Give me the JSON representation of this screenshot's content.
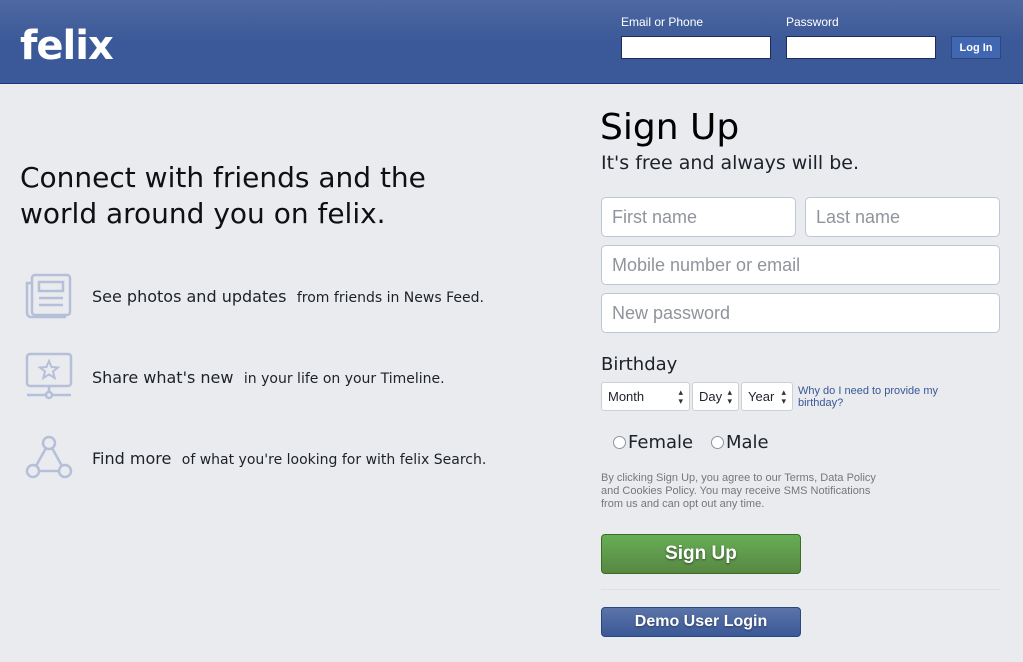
{
  "header": {
    "logo": "felix",
    "email_label": "Email or Phone",
    "password_label": "Password",
    "email_value": "",
    "password_value": "",
    "login_button": "Log In"
  },
  "left": {
    "headline": "Connect with friends and the world around you on felix.",
    "features": [
      {
        "icon": "news-feed-icon",
        "bold": "See photos and updates",
        "text": "from friends in News Feed."
      },
      {
        "icon": "timeline-icon",
        "bold": "Share what's new",
        "text": "in your life on your Timeline."
      },
      {
        "icon": "search-graph-icon",
        "bold": "Find more",
        "text": "of what you're looking for with felix Search."
      }
    ]
  },
  "signup": {
    "title": "Sign Up",
    "subtitle": "It's free and always will be.",
    "first_name_placeholder": "First name",
    "last_name_placeholder": "Last name",
    "mobile_placeholder": "Mobile number or email",
    "password_placeholder": "New password",
    "birthday_label": "Birthday",
    "month": "Month",
    "day": "Day",
    "year": "Year",
    "why_link": "Why do I need to provide my birthday?",
    "female": "Female",
    "male": "Male",
    "terms": "By clicking Sign Up, you agree to our Terms, Data Policy and Cookies Policy. You may receive SMS Notifications from us and can opt out any time.",
    "signup_button": "Sign Up",
    "demo_button": "Demo User Login"
  },
  "colors": {
    "header": "#3b5998",
    "background": "#e9ebee",
    "signup_green": "#69a74e",
    "link": "#385898"
  }
}
